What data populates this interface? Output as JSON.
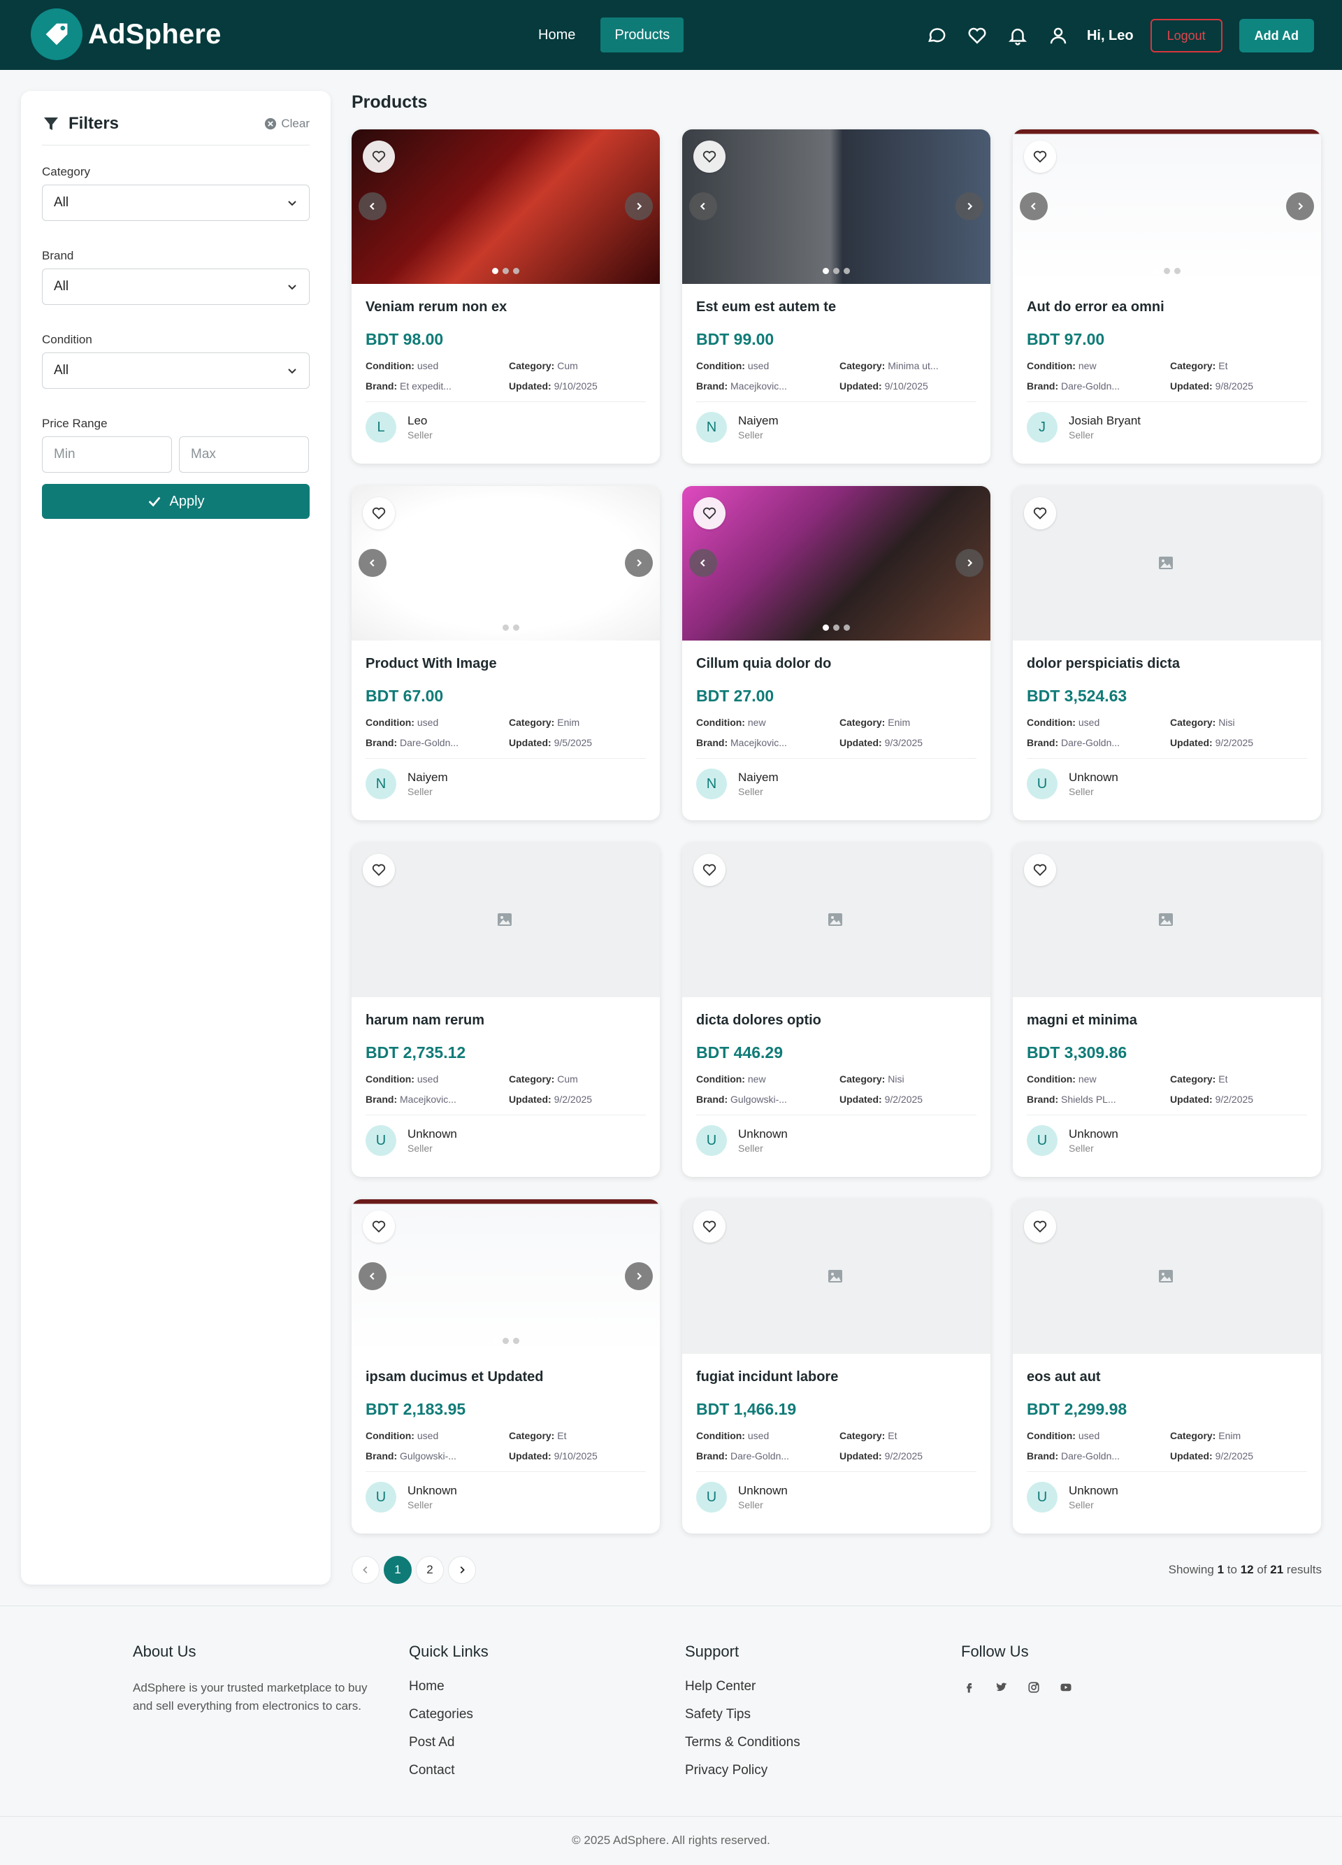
{
  "header": {
    "brand": "AdSphere",
    "nav": [
      {
        "label": "Home",
        "active": false
      },
      {
        "label": "Products",
        "active": true
      }
    ],
    "icons": [
      "chat-icon",
      "heart-icon",
      "bell-icon",
      "user-icon"
    ],
    "greeting": "Hi, Leo",
    "logout_label": "Logout",
    "add_ad_label": "Add Ad"
  },
  "colors": {
    "header_bg": "#063a3c",
    "accent": "#0f7b77",
    "logout": "#e0464e"
  },
  "filters": {
    "title": "Filters",
    "clear_label": "Clear",
    "category_label": "Category",
    "category_value": "All",
    "brand_label": "Brand",
    "brand_value": "All",
    "condition_label": "Condition",
    "condition_value": "All",
    "price_label": "Price Range",
    "min_placeholder": "Min",
    "max_placeholder": "Max",
    "apply_label": "Apply"
  },
  "main": {
    "title": "Products",
    "cards": [
      {
        "title": "Veniam rerum non ex",
        "price": "BDT 98.00",
        "condition": "used",
        "category": "Cum",
        "brand": "Et expedit...",
        "updated": "9/10/2025",
        "seller": "Leo",
        "avatar": "L",
        "role": "Seller"
      },
      {
        "title": "Est eum est autem te",
        "price": "BDT 99.00",
        "condition": "used",
        "category": "Minima ut...",
        "brand": "Macejkovic...",
        "updated": "9/10/2025",
        "seller": "Naiyem",
        "avatar": "N",
        "role": "Seller"
      },
      {
        "title": "Aut do error ea omni",
        "price": "BDT 97.00",
        "condition": "new",
        "category": "Et",
        "brand": "Dare-Goldn...",
        "updated": "9/8/2025",
        "seller": "Josiah Bryant",
        "avatar": "J",
        "role": "Seller"
      },
      {
        "title": "Product With Image",
        "price": "BDT 67.00",
        "condition": "used",
        "category": "Enim",
        "brand": "Dare-Goldn...",
        "updated": "9/5/2025",
        "seller": "Naiyem",
        "avatar": "N",
        "role": "Seller"
      },
      {
        "title": "Cillum quia dolor do",
        "price": "BDT 27.00",
        "condition": "new",
        "category": "Enim",
        "brand": "Macejkovic...",
        "updated": "9/3/2025",
        "seller": "Naiyem",
        "avatar": "N",
        "role": "Seller"
      },
      {
        "title": "dolor perspiciatis dicta",
        "price": "BDT 3,524.63",
        "condition": "used",
        "category": "Nisi",
        "brand": "Dare-Goldn...",
        "updated": "9/2/2025",
        "seller": "Unknown",
        "avatar": "U",
        "role": "Seller"
      },
      {
        "title": "harum nam rerum",
        "price": "BDT 2,735.12",
        "condition": "used",
        "category": "Cum",
        "brand": "Macejkovic...",
        "updated": "9/2/2025",
        "seller": "Unknown",
        "avatar": "U",
        "role": "Seller"
      },
      {
        "title": "dicta dolores optio",
        "price": "BDT 446.29",
        "condition": "new",
        "category": "Nisi",
        "brand": "Gulgowski-...",
        "updated": "9/2/2025",
        "seller": "Unknown",
        "avatar": "U",
        "role": "Seller"
      },
      {
        "title": "magni et minima",
        "price": "BDT 3,309.86",
        "condition": "new",
        "category": "Et",
        "brand": "Shields PL...",
        "updated": "9/2/2025",
        "seller": "Unknown",
        "avatar": "U",
        "role": "Seller"
      },
      {
        "title": "ipsam ducimus et Updated",
        "price": "BDT 2,183.95",
        "condition": "used",
        "category": "Et",
        "brand": "Gulgowski-...",
        "updated": "9/10/2025",
        "seller": "Unknown",
        "avatar": "U",
        "role": "Seller"
      },
      {
        "title": "fugiat incidunt labore",
        "price": "BDT 1,466.19",
        "condition": "used",
        "category": "Et",
        "brand": "Dare-Goldn...",
        "updated": "9/2/2025",
        "seller": "Unknown",
        "avatar": "U",
        "role": "Seller"
      },
      {
        "title": "eos aut aut",
        "price": "BDT 2,299.98",
        "condition": "used",
        "category": "Enim",
        "brand": "Dare-Goldn...",
        "updated": "9/2/2025",
        "seller": "Unknown",
        "avatar": "U",
        "role": "Seller"
      }
    ],
    "labels": {
      "condition": "Condition:",
      "category": "Category:",
      "brand": "Brand:",
      "updated": "Updated:"
    }
  },
  "pagination": {
    "pages": [
      "1",
      "2"
    ],
    "current": "1",
    "showing_prefix": "Showing",
    "from": "1",
    "to_word": "to",
    "to": "12",
    "of_word": "of",
    "total": "21",
    "results_word": "results"
  },
  "footer": {
    "about_title": "About Us",
    "about_text": "AdSphere is your trusted marketplace to buy and sell everything from electronics to cars.",
    "quick_title": "Quick Links",
    "quick_links": [
      "Home",
      "Categories",
      "Post Ad",
      "Contact"
    ],
    "support_title": "Support",
    "support_links": [
      "Help Center",
      "Safety Tips",
      "Terms & Conditions",
      "Privacy Policy"
    ],
    "follow_title": "Follow Us",
    "social_icons": [
      "facebook-icon",
      "twitter-icon",
      "instagram-icon",
      "youtube-icon"
    ],
    "copyright": "© 2025 AdSphere. All rights reserved."
  }
}
